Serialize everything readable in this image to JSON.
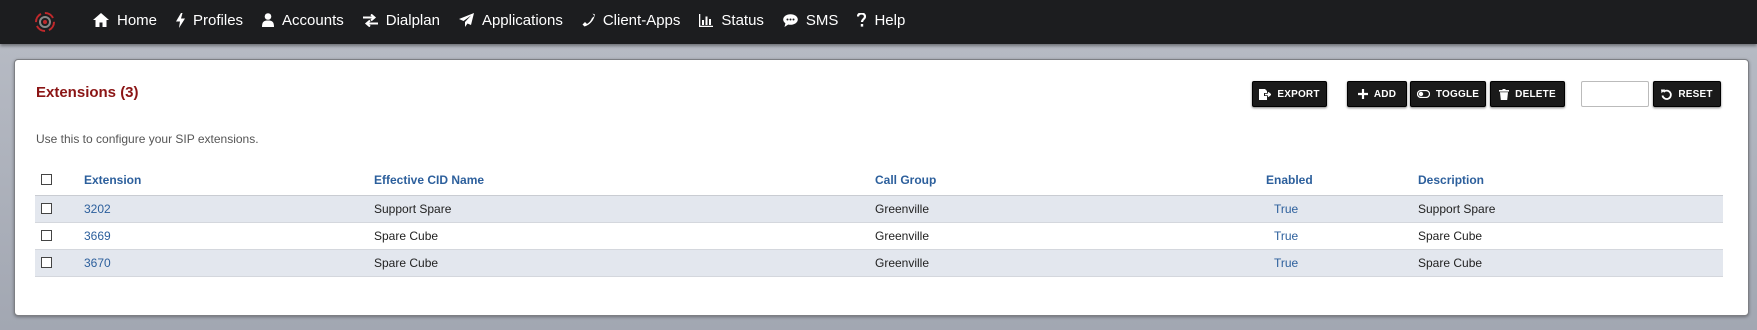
{
  "nav": {
    "items": [
      {
        "label": "Home",
        "icon": "home-icon"
      },
      {
        "label": "Profiles",
        "icon": "bolt-icon"
      },
      {
        "label": "Accounts",
        "icon": "user-icon"
      },
      {
        "label": "Dialplan",
        "icon": "exchange-icon"
      },
      {
        "label": "Applications",
        "icon": "paper-plane-icon"
      },
      {
        "label": "Client-Apps",
        "icon": "phone-icon"
      },
      {
        "label": "Status",
        "icon": "bar-chart-icon"
      },
      {
        "label": "SMS",
        "icon": "comment-icon"
      },
      {
        "label": "Help",
        "icon": "question-icon"
      }
    ]
  },
  "page": {
    "title": "Extensions (3)",
    "description": "Use this to configure your SIP extensions."
  },
  "toolbar": {
    "export_label": "EXPORT",
    "add_label": "ADD",
    "toggle_label": "TOGGLE",
    "delete_label": "DELETE",
    "search_placeholder": "",
    "reset_label": "RESET"
  },
  "table": {
    "columns": [
      "Extension",
      "Effective CID Name",
      "Call Group",
      "Enabled",
      "Description"
    ],
    "rows": [
      {
        "extension": "3202",
        "cid_name": "Support Spare",
        "call_group": "Greenville",
        "enabled": "True",
        "description": "Support Spare"
      },
      {
        "extension": "3669",
        "cid_name": "Spare Cube",
        "call_group": "Greenville",
        "enabled": "True",
        "description": "Spare Cube"
      },
      {
        "extension": "3670",
        "cid_name": "Spare Cube",
        "call_group": "Greenville",
        "enabled": "True",
        "description": "Spare Cube"
      }
    ]
  },
  "colors": {
    "title": "#8b1515",
    "link": "#2c5f9c",
    "topbar": "#1c1d1f"
  }
}
